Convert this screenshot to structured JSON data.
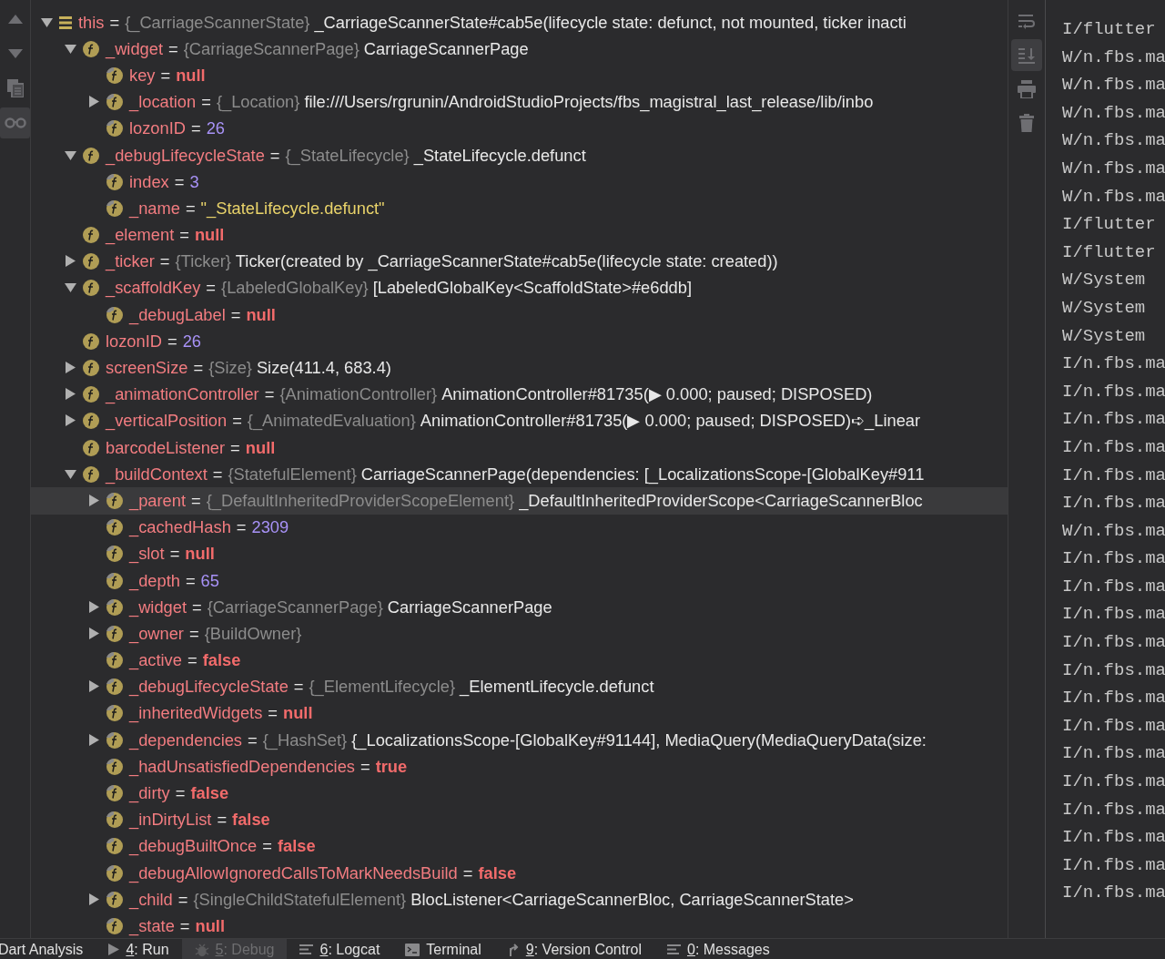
{
  "gutter_tools": [
    {
      "kind": "up",
      "selected": false
    },
    {
      "kind": "down",
      "selected": false
    },
    {
      "kind": "copy",
      "selected": false
    },
    {
      "kind": "watch",
      "selected": true
    }
  ],
  "variables": [
    {
      "kind": "this",
      "name": "this",
      "eq": "=",
      "type": "{_CarriageScannerState}",
      "value": "_CarriageScannerState#cab5e(lifecycle state: defunct, not mounted, ticker inacti",
      "expanded": true,
      "selected": false,
      "children": [
        {
          "kind": "object",
          "name": "_widget",
          "eq": "=",
          "type": "{CarriageScannerPage}",
          "value": "CarriageScannerPage",
          "expanded": true,
          "selected": false,
          "children": [
            {
              "kind": "null",
              "final": true,
              "name": "key",
              "eq": "=",
              "value": "null",
              "selected": false
            },
            {
              "kind": "object",
              "final": true,
              "name": "_location",
              "eq": "=",
              "type": "{_Location}",
              "value": "file:///Users/rgrunin/AndroidStudioProjects/fbs_magistral_last_release/lib/inbo",
              "expanded": false,
              "selected": false
            },
            {
              "kind": "number",
              "final": true,
              "name": "lozonID",
              "eq": "=",
              "value": "26",
              "selected": false
            }
          ]
        },
        {
          "kind": "object",
          "name": "_debugLifecycleState",
          "eq": "=",
          "type": "{_StateLifecycle}",
          "value": "_StateLifecycle.defunct",
          "expanded": true,
          "selected": false,
          "children": [
            {
              "kind": "number",
              "final": true,
              "name": "index",
              "eq": "=",
              "value": "3",
              "selected": false
            },
            {
              "kind": "string",
              "final": true,
              "name": "_name",
              "eq": "=",
              "value": "\"_StateLifecycle.defunct\"",
              "selected": false
            }
          ]
        },
        {
          "kind": "null",
          "name": "_element",
          "eq": "=",
          "value": "null",
          "selected": false
        },
        {
          "kind": "object",
          "name": "_ticker",
          "eq": "=",
          "type": "{Ticker}",
          "value": "Ticker(created by _CarriageScannerState#cab5e(lifecycle state: created))",
          "expanded": false,
          "selected": false
        },
        {
          "kind": "object",
          "name": "_scaffoldKey",
          "eq": "=",
          "type": "{LabeledGlobalKey}",
          "value": "[LabeledGlobalKey<ScaffoldState>#e6ddb]",
          "expanded": true,
          "selected": false,
          "children": [
            {
              "kind": "null",
              "final": true,
              "name": "_debugLabel",
              "eq": "=",
              "value": "null",
              "selected": false
            }
          ]
        },
        {
          "kind": "number",
          "name": "lozonID",
          "eq": "=",
          "value": "26",
          "selected": false
        },
        {
          "kind": "object",
          "name": "screenSize",
          "eq": "=",
          "type": "{Size}",
          "value": "Size(411.4, 683.4)",
          "expanded": false,
          "selected": false
        },
        {
          "kind": "object",
          "name": "_animationController",
          "eq": "=",
          "type": "{AnimationController}",
          "value": "AnimationController#81735(▶ 0.000; paused; DISPOSED)",
          "expanded": false,
          "selected": false
        },
        {
          "kind": "object",
          "name": "_verticalPosition",
          "eq": "=",
          "type": "{_AnimatedEvaluation}",
          "value": "AnimationController#81735(▶ 0.000; paused; DISPOSED)➪_Linear",
          "expanded": false,
          "selected": false
        },
        {
          "kind": "null",
          "name": "barcodeListener",
          "eq": "=",
          "value": "null",
          "selected": false
        },
        {
          "kind": "object",
          "name": "_buildContext",
          "eq": "=",
          "type": "{StatefulElement}",
          "value": "CarriageScannerPage(dependencies: [_LocalizationsScope-[GlobalKey#911",
          "expanded": true,
          "selected": false,
          "children": [
            {
              "kind": "object",
              "final": true,
              "name": "_parent",
              "eq": "=",
              "type": "{_DefaultInheritedProviderScopeElement}",
              "value": "_DefaultInheritedProviderScope<CarriageScannerBloc",
              "expanded": false,
              "selected": true
            },
            {
              "kind": "number",
              "final": true,
              "name": "_cachedHash",
              "eq": "=",
              "value": "2309",
              "selected": false
            },
            {
              "kind": "null",
              "final": true,
              "name": "_slot",
              "eq": "=",
              "value": "null",
              "selected": false
            },
            {
              "kind": "number",
              "final": true,
              "name": "_depth",
              "eq": "=",
              "value": "65",
              "selected": false
            },
            {
              "kind": "object",
              "final": true,
              "name": "_widget",
              "eq": "=",
              "type": "{CarriageScannerPage}",
              "value": "CarriageScannerPage",
              "expanded": false,
              "selected": false
            },
            {
              "kind": "object",
              "final": true,
              "name": "_owner",
              "eq": "=",
              "type": "{BuildOwner}",
              "expanded": false,
              "selected": false
            },
            {
              "kind": "bool",
              "final": true,
              "name": "_active",
              "eq": "=",
              "value": "false",
              "selected": false
            },
            {
              "kind": "object",
              "final": true,
              "name": "_debugLifecycleState",
              "eq": "=",
              "type": "{_ElementLifecycle}",
              "value": "_ElementLifecycle.defunct",
              "expanded": false,
              "selected": false
            },
            {
              "kind": "null",
              "final": true,
              "name": "_inheritedWidgets",
              "eq": "=",
              "value": "null",
              "selected": false
            },
            {
              "kind": "object",
              "final": true,
              "name": "_dependencies",
              "eq": "=",
              "type": "{_HashSet}",
              "value": "{_LocalizationsScope-[GlobalKey#91144], MediaQuery(MediaQueryData(size:",
              "expanded": false,
              "selected": false
            },
            {
              "kind": "bool",
              "final": true,
              "name": "_hadUnsatisfiedDependencies",
              "eq": "=",
              "value": "true",
              "selected": false
            },
            {
              "kind": "bool",
              "final": true,
              "name": "_dirty",
              "eq": "=",
              "value": "false",
              "selected": false
            },
            {
              "kind": "bool",
              "final": true,
              "name": "_inDirtyList",
              "eq": "=",
              "value": "false",
              "selected": false
            },
            {
              "kind": "bool",
              "final": true,
              "name": "_debugBuiltOnce",
              "eq": "=",
              "value": "false",
              "selected": false
            },
            {
              "kind": "bool",
              "final": true,
              "name": "_debugAllowIgnoredCallsToMarkNeedsBuild",
              "eq": "=",
              "value": "false",
              "selected": false
            },
            {
              "kind": "object",
              "final": true,
              "name": "_child",
              "eq": "=",
              "type": "{SingleChildStatefulElement}",
              "value": "BlocListener<CarriageScannerBloc, CarriageScannerState>",
              "expanded": false,
              "selected": false
            },
            {
              "kind": "null",
              "final": true,
              "name": "_state",
              "eq": "=",
              "value": "null",
              "selected": false
            }
          ]
        }
      ]
    }
  ],
  "log_tools": [
    {
      "kind": "wrap",
      "selected": false
    },
    {
      "kind": "scroll_end",
      "selected": true
    },
    {
      "kind": "print",
      "selected": false
    },
    {
      "kind": "clear",
      "selected": false
    }
  ],
  "log_lines": [
    "I/flutter",
    "W/n.fbs.ma",
    "W/n.fbs.ma",
    "W/n.fbs.ma",
    "W/n.fbs.ma",
    "W/n.fbs.ma",
    "W/n.fbs.ma",
    "I/flutter",
    "I/flutter",
    "W/System",
    "W/System",
    "W/System",
    "I/n.fbs.ma",
    "I/n.fbs.ma",
    "I/n.fbs.ma",
    "I/n.fbs.ma",
    "I/n.fbs.ma",
    "I/n.fbs.ma",
    "W/n.fbs.ma",
    "I/n.fbs.ma",
    "I/n.fbs.ma",
    "I/n.fbs.ma",
    "I/n.fbs.ma",
    "I/n.fbs.ma",
    "I/n.fbs.ma",
    "I/n.fbs.ma",
    "I/n.fbs.ma",
    "I/n.fbs.ma",
    "I/n.fbs.ma",
    "I/n.fbs.ma",
    "I/n.fbs.ma",
    "I/n.fbs.ma"
  ],
  "tool_tabs": [
    {
      "kind": "analysis",
      "label": "Dart Analysis",
      "selected": false
    },
    {
      "kind": "run",
      "mnemonic": "4",
      "label": ": Run",
      "selected": false
    },
    {
      "kind": "debug",
      "mnemonic": "5",
      "label": ": Debug",
      "selected": true
    },
    {
      "kind": "logcat",
      "mnemonic": "6",
      "label": ": Logcat",
      "selected": false
    },
    {
      "kind": "terminal",
      "label": "Terminal",
      "selected": false
    },
    {
      "kind": "vcs",
      "mnemonic": "9",
      "label": ": Version Control",
      "selected": false
    },
    {
      "kind": "messages",
      "mnemonic": "0",
      "label": ": Messages",
      "selected": false
    }
  ]
}
